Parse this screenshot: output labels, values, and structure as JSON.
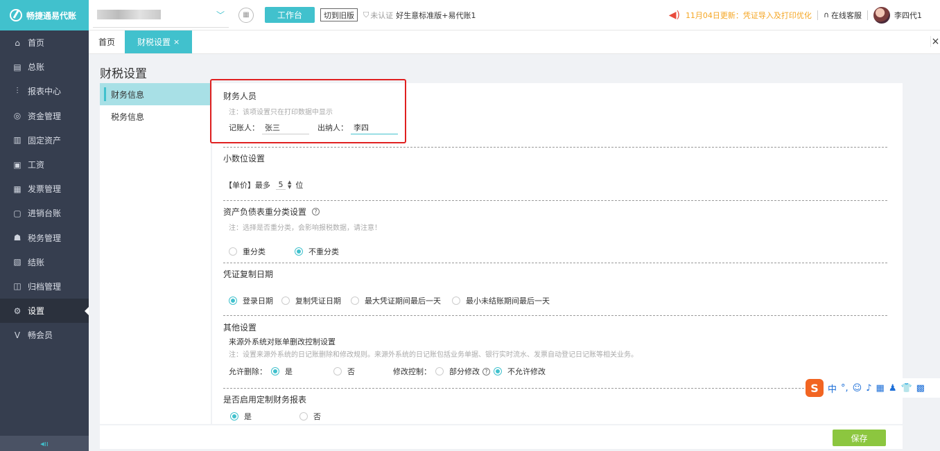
{
  "sidebar": {
    "logo_text": "畅捷通易代账",
    "items": [
      {
        "label": "首页",
        "icon": "home-icon",
        "glyph": "⌂"
      },
      {
        "label": "总账",
        "icon": "ledger-icon",
        "glyph": "▤"
      },
      {
        "label": "报表中心",
        "icon": "chart-icon",
        "glyph": "⫶"
      },
      {
        "label": "资金管理",
        "icon": "fund-icon",
        "glyph": "◎"
      },
      {
        "label": "固定资产",
        "icon": "asset-icon",
        "glyph": "▥"
      },
      {
        "label": "工资",
        "icon": "salary-icon",
        "glyph": "▣"
      },
      {
        "label": "发票管理",
        "icon": "invoice-icon",
        "glyph": "▦"
      },
      {
        "label": "进销台账",
        "icon": "inventory-icon",
        "glyph": "▢"
      },
      {
        "label": "税务管理",
        "icon": "tax-icon",
        "glyph": "☗"
      },
      {
        "label": "结账",
        "icon": "closing-icon",
        "glyph": "▧"
      },
      {
        "label": "归档管理",
        "icon": "archive-icon",
        "glyph": "◫"
      },
      {
        "label": "设置",
        "icon": "gear-icon",
        "glyph": "⚙"
      },
      {
        "label": "畅会员",
        "icon": "vip-icon",
        "glyph": "V"
      }
    ],
    "collapse_glyph": "◂ıı"
  },
  "topbar": {
    "workbench_label": "工作台",
    "old_version_label": "切到旧版",
    "cert_status": "未认证",
    "product_name": "好生意标准版+易代账1",
    "notice": "11月04日更新：凭证导入及打印优化",
    "service_label": "在线客服",
    "user_name": "李四代1"
  },
  "tabs": [
    {
      "label": "首页"
    },
    {
      "label": "财税设置",
      "close": "×"
    }
  ],
  "page": {
    "title": "财税设置",
    "subnav": [
      "财务信息",
      "税务信息"
    ]
  },
  "finance_staff": {
    "title": "财务人员",
    "note": "注：该项设置只在打印数据中显示",
    "bookkeeper_label": "记账人：",
    "bookkeeper_value": "张三",
    "cashier_label": "出纳人：",
    "cashier_value": "李四"
  },
  "decimal": {
    "title": "小数位设置",
    "prefix": "【单价】最多",
    "value": "5",
    "suffix": "位"
  },
  "balance_sheet": {
    "title": "资产负债表重分类设置",
    "note": "注：选择是否重分类，会影响报税数据，请注意！",
    "options": [
      "重分类",
      "不重分类"
    ],
    "selected": 1
  },
  "voucher_copy": {
    "title": "凭证复制日期",
    "options": [
      "登录日期",
      "复制凭证日期",
      "最大凭证期间最后一天",
      "最小未结账期间最后一天"
    ],
    "selected": 0
  },
  "other": {
    "title": "其他设置",
    "subtitle": "来源外系统对账单删改控制设置",
    "note": "注：设置来源外系统的日记账删除和修改规则。来源外系统的日记账包括业务单据、银行实时流水、发票自动登记日记账等相关业务。",
    "allow_delete_label": "允许删除：",
    "yes": "是",
    "no": "否",
    "modify_label": "修改控制：",
    "partial_modify": "部分修改",
    "no_modify": "不允许修改"
  },
  "custom_report": {
    "title": "是否启用定制财务报表",
    "yes": "是",
    "no": "否"
  },
  "save_label": "保存",
  "ime": {
    "logo": "S",
    "items": [
      "中",
      "°,",
      "☺",
      "♪",
      "▦",
      "♟",
      "👕",
      "▩"
    ]
  },
  "colors": {
    "accent": "#41c1cd",
    "sidebar": "#363e4f",
    "save": "#8cc63f",
    "highlight_box": "#e02020",
    "notice": "#f5a623"
  }
}
